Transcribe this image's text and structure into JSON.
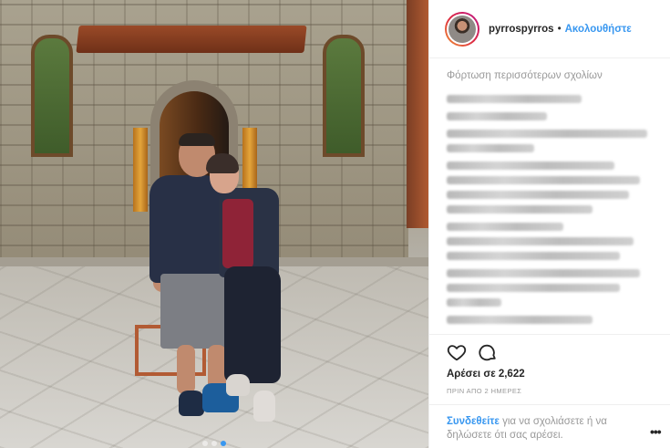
{
  "post": {
    "username": "pyrrospyrros",
    "separator": "•",
    "follow_label": "Ακολουθήστε",
    "load_more_label": "Φόρτωση περισσότερων σχολίων",
    "likes_label": "Αρέσει σε 2,622",
    "time_label": "ΠΡΙΝ ΑΠΟ 2 ΗΜΕΡΕΣ",
    "login_link_label": "Συνδεθείτε",
    "login_rest_text": " για να σχολιάσετε ή να δηλώσετε ότι σας αρέσει.",
    "more_label": "•••",
    "carousel": {
      "count": 3,
      "active_index": 2
    }
  },
  "icons": {
    "like": "heart-icon",
    "comment": "comment-bubble-icon",
    "more": "ellipsis-icon"
  },
  "colors": {
    "link_blue": "#3897f0",
    "text_dark": "#262626",
    "text_muted": "#999999",
    "divider": "#efefef"
  }
}
